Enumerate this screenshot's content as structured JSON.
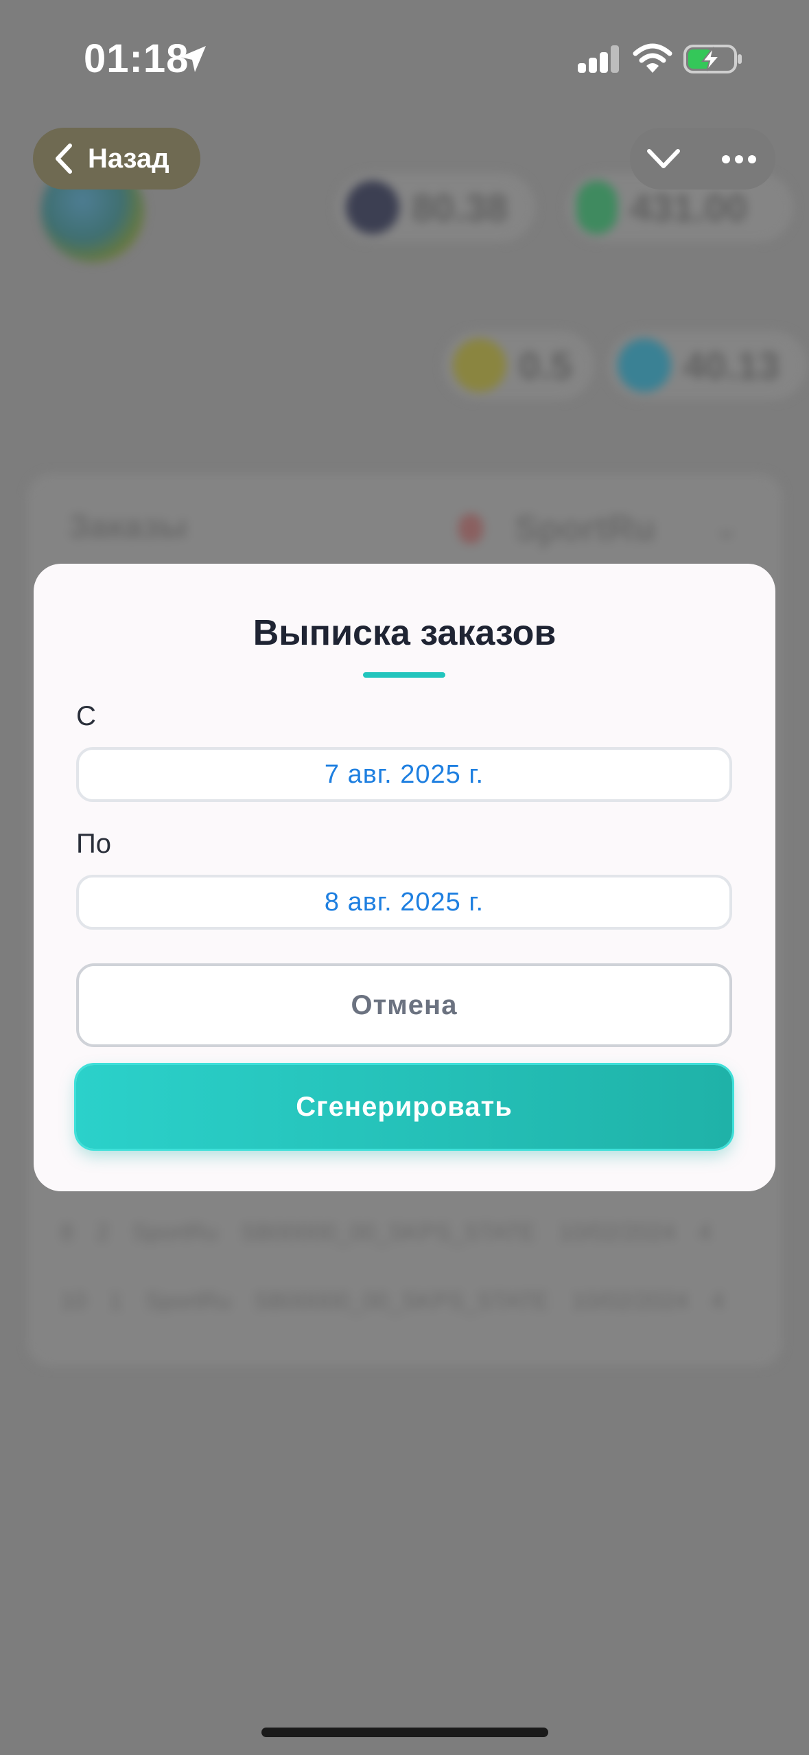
{
  "status_bar": {
    "time": "01:18",
    "icons": [
      "location-arrow-icon",
      "cellular-signal-icon",
      "wifi-icon",
      "battery-charging-icon"
    ],
    "battery_color": "#34c759"
  },
  "nav": {
    "back_label": "Назад",
    "icons": [
      "chevron-left-icon",
      "chevron-down-icon",
      "more-icon"
    ]
  },
  "background": {
    "balances": [
      "80.38",
      "431.00",
      "0.5",
      "40.13"
    ],
    "card_title": "Заказы",
    "filter_value": "SportRu",
    "rows": [
      "8  2  SportRu  SB00000_00_SKPS_STATE  10/02/2024  4",
      "10  1  SportRu  SB00000_00_SKPS_STATE  10/02/2024  4"
    ]
  },
  "modal": {
    "title": "Выписка заказов",
    "from_label": "С",
    "from_value": "7 авг. 2025 г.",
    "to_label": "По",
    "to_value": "8 авг. 2025 г.",
    "cancel_label": "Отмена",
    "generate_label": "Сгенерировать",
    "accent_color": "#22c5bd",
    "date_text_color": "#1e7fe0"
  }
}
